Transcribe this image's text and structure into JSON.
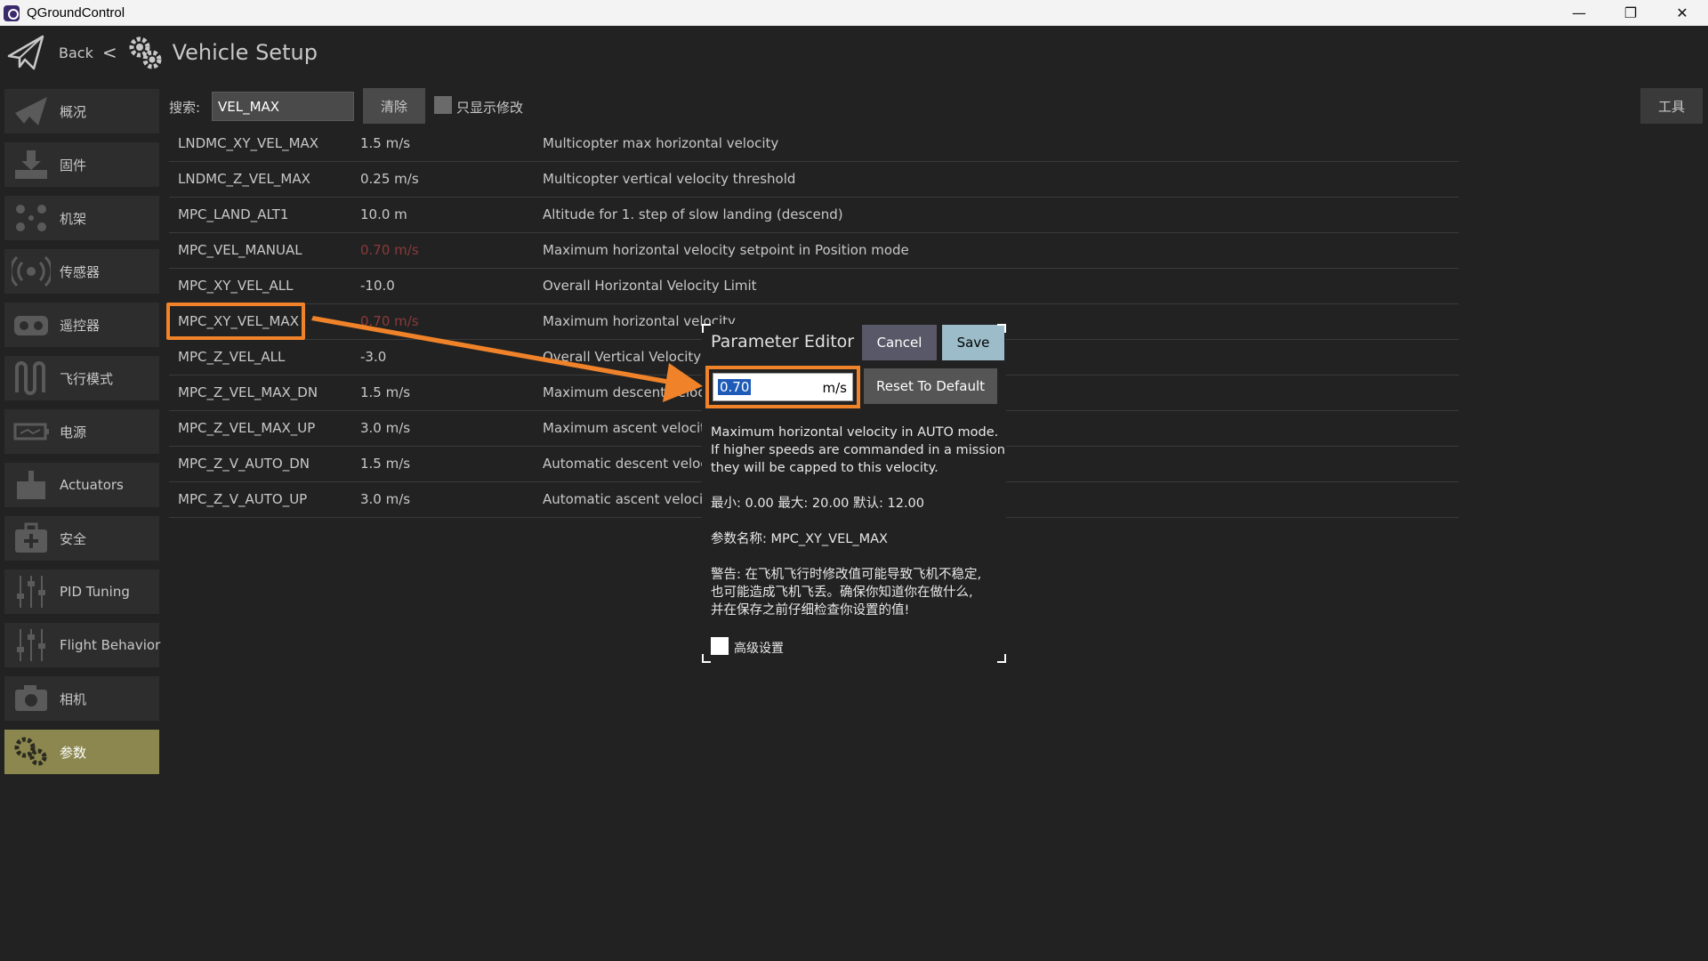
{
  "window": {
    "title": "QGroundControl",
    "controls": [
      "—",
      "❐",
      "✕"
    ]
  },
  "toolbar": {
    "back_label": "Back",
    "separator": "<",
    "page_title": "Vehicle Setup"
  },
  "sidebar": {
    "items": [
      {
        "label": "概况",
        "icon": "paper-plane-icon"
      },
      {
        "label": "固件",
        "icon": "download-icon"
      },
      {
        "label": "机架",
        "icon": "frame-icon"
      },
      {
        "label": "传感器",
        "icon": "sensor-icon"
      },
      {
        "label": "遥控器",
        "icon": "remote-control-icon"
      },
      {
        "label": "飞行模式",
        "icon": "flight-mode-icon"
      },
      {
        "label": "电源",
        "icon": "battery-icon"
      },
      {
        "label": "Actuators",
        "icon": "actuator-icon"
      },
      {
        "label": "安全",
        "icon": "safety-icon"
      },
      {
        "label": "PID Tuning",
        "icon": "sliders-icon"
      },
      {
        "label": "Flight Behavior",
        "icon": "sliders-icon"
      },
      {
        "label": "相机",
        "icon": "camera-icon"
      },
      {
        "label": "参数",
        "icon": "gears-icon",
        "active": true
      }
    ]
  },
  "search": {
    "label": "搜索:",
    "value": "VEL_MAX",
    "clear_label": "清除",
    "only_modified_label": "只显示修改",
    "tools_label": "工具"
  },
  "params": [
    {
      "name": "LNDMC_XY_VEL_MAX",
      "value": "1.5 m/s",
      "desc": "Multicopter max horizontal velocity",
      "modified": false
    },
    {
      "name": "LNDMC_Z_VEL_MAX",
      "value": "0.25 m/s",
      "desc": "Multicopter vertical velocity threshold",
      "modified": false
    },
    {
      "name": "MPC_LAND_ALT1",
      "value": "10.0 m",
      "desc": "Altitude for 1. step of slow landing (descend)",
      "modified": false
    },
    {
      "name": "MPC_VEL_MANUAL",
      "value": "0.70 m/s",
      "desc": "Maximum horizontal velocity setpoint in Position mode",
      "modified": true
    },
    {
      "name": "MPC_XY_VEL_ALL",
      "value": "-10.0",
      "desc": "Overall Horizontal Velocity Limit",
      "modified": false
    },
    {
      "name": "MPC_XY_VEL_MAX",
      "value": "0.70 m/s",
      "desc": "Maximum horizontal velocity",
      "modified": true
    },
    {
      "name": "MPC_Z_VEL_ALL",
      "value": "-3.0",
      "desc": "Overall Vertical Velocity Li",
      "modified": false
    },
    {
      "name": "MPC_Z_VEL_MAX_DN",
      "value": "1.5 m/s",
      "desc": "Maximum descent velocity",
      "modified": false
    },
    {
      "name": "MPC_Z_VEL_MAX_UP",
      "value": "3.0 m/s",
      "desc": "Maximum ascent velocity",
      "modified": false
    },
    {
      "name": "MPC_Z_V_AUTO_DN",
      "value": "1.5 m/s",
      "desc": "Automatic descent velocity",
      "modified": false
    },
    {
      "name": "MPC_Z_V_AUTO_UP",
      "value": "3.0 m/s",
      "desc": "Automatic ascent velocity",
      "modified": false
    }
  ],
  "editor": {
    "title": "Parameter Editor",
    "cancel_label": "Cancel",
    "save_label": "Save",
    "value": "0.70",
    "unit": "m/s",
    "reset_label": "Reset To Default",
    "description": [
      "Maximum horizontal velocity in AUTO mode.",
      "If higher speeds are commanded in a mission",
      "they will be capped to this velocity."
    ],
    "range": "最小: 0.00   最大: 20.00   默认: 12.00",
    "param_name": "参数名称: MPC_XY_VEL_MAX",
    "warning": [
      "警告: 在飞机飞行时修改值可能导致飞机不稳定,",
      "也可能造成飞机飞丢。确保你知道你在做什么,",
      "并在保存之前仔细检查你设置的值!"
    ],
    "advanced_label": "高级设置"
  },
  "colors": {
    "background": "#222222",
    "sidebar_item": "#2d2d2d",
    "sidebar_active": "#8b874f",
    "modified_value": "#8a3a3a",
    "highlight": "#f0832a",
    "save_button": "#9bbcc8"
  }
}
